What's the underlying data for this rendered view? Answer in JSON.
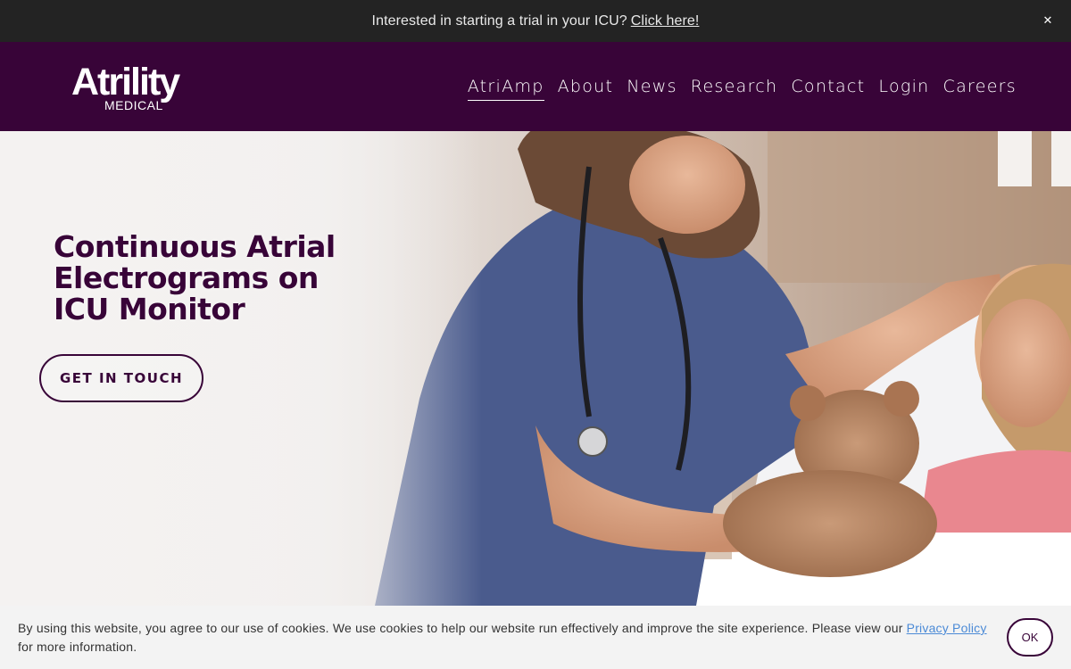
{
  "announcement": {
    "text": "Interested in starting a trial in your ICU?",
    "link_text": "Click here!",
    "close_icon": "close-icon",
    "close_glyph": "✕"
  },
  "header": {
    "logo_wordmark": "Atrility",
    "logo_sub": "MEDICAL",
    "background": "#380438",
    "nav": [
      {
        "label": "AtriAmp",
        "active": true
      },
      {
        "label": "About"
      },
      {
        "label": "News"
      },
      {
        "label": "Research"
      },
      {
        "label": "Contact"
      },
      {
        "label": "Login"
      },
      {
        "label": "Careers"
      }
    ]
  },
  "hero": {
    "title": "Continuous Atrial Electrograms on ICU Monitor",
    "cta_label": "GET IN TOUCH",
    "accent": "#380438"
  },
  "cookie": {
    "text_before": "By using this website, you agree to our use of cookies. We use cookies to help our website run effectively and improve the site experience. Please view our",
    "link_text": "Privacy Policy",
    "text_after": "for more information.",
    "ok_label": "OK",
    "link_color": "#4b8ad6"
  }
}
